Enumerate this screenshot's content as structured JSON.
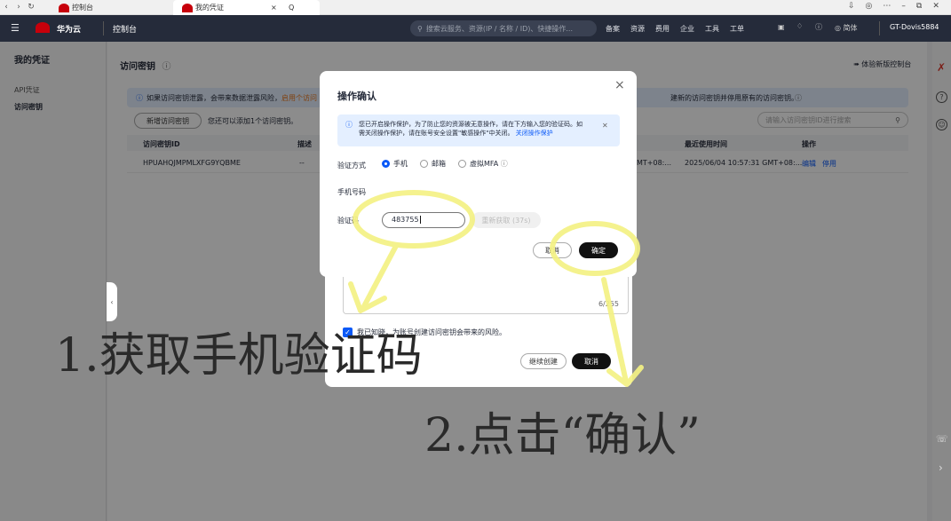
{
  "browser": {
    "tab1_title": "控制台",
    "tab2_title": "我的凭证",
    "tab_close": "×",
    "tab_search": "Q"
  },
  "topnav": {
    "brand": "华为云",
    "console": "控制台",
    "search_placeholder": "搜索云服务、资源(IP / 名称 / ID)、快捷操作...",
    "items": [
      "备案",
      "资源",
      "费用",
      "企业",
      "工具",
      "工单"
    ],
    "lang": "简体",
    "account": "GT-Dovis5884"
  },
  "sidebar": {
    "title": "我的凭证",
    "items": [
      "API凭证",
      "访问密钥"
    ]
  },
  "page": {
    "title": "访问密钥",
    "try_new": "体验新版控制台",
    "info_text": "如果访问密钥泄露，会带来数据泄露风险，",
    "info_link": "启用个访问",
    "info_tail": "建新的访问密钥并停用原有的访问密钥。",
    "create_button": "新增访问密钥",
    "quota_text": "您还可以添加1个访问密钥。",
    "search_placeholder": "请输入访问密钥ID进行搜索",
    "columns": [
      "访问密钥ID",
      "描述",
      "最近使用时间",
      "操作"
    ],
    "row": {
      "id": "HPUAHQJMPMLXFG9YQBME",
      "desc": "--",
      "created_partial": "MT+08:...",
      "last_used": "2025/06/04 10:57:31 GMT+08:...",
      "edit": "编辑",
      "disable": "停用"
    }
  },
  "back_modal": {
    "char_count": "6/255",
    "agree_text": "我已知晓，为账号创建访问密钥会带来的风险。",
    "continue_button": "继续创建",
    "cancel_button": "取消"
  },
  "confirm_modal": {
    "title": "操作确认",
    "close": "×",
    "notice": "您已开启操作保护，为了防止您的资源被无意操作，请在下方输入您的验证码。如需关闭操作保护，请在账号安全设置\"敏感操作\"中关闭。",
    "notice_link": "关闭操作保护",
    "verify_label": "验证方式",
    "options": [
      "手机",
      "邮箱",
      "虚拟MFA"
    ],
    "phone_label": "手机号码",
    "code_label": "验证码",
    "code_value": "483755",
    "resend": "重新获取 (37s)",
    "cancel": "取消",
    "ok": "确定"
  },
  "annotations": {
    "step1": "1.获取手机验证码",
    "step2": "2.点击“确认”"
  },
  "colors": {
    "brand_red": "#c7000b",
    "link_blue": "#0a59f7",
    "highlight_yellow": "#f4f184"
  }
}
